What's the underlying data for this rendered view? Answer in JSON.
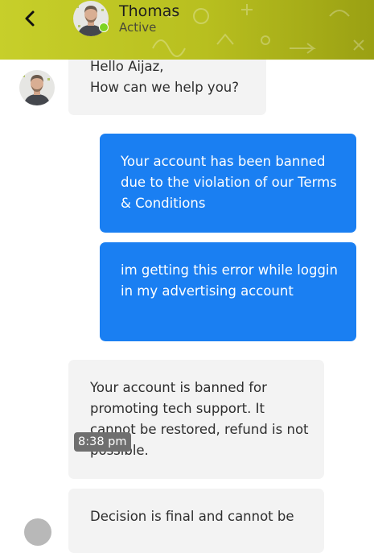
{
  "header": {
    "contact_name": "Thomas",
    "status": "Active",
    "back_icon": "chevron-left-icon",
    "avatar": "avatar",
    "background_color": "#c0c824",
    "online_color": "#7ed321"
  },
  "messages": [
    {
      "direction": "incoming",
      "text": "Hello Aijaz,\nHow can we help you?"
    },
    {
      "direction": "outgoing",
      "text": "Your account has been banned due to the violation of our Terms & Conditions"
    },
    {
      "direction": "outgoing",
      "text": "im getting this error while loggin in my advertising account"
    },
    {
      "direction": "incoming",
      "text": "Your account is banned for promoting tech support. It cannot be restored, refund is not possible."
    },
    {
      "direction": "incoming",
      "text": "Decision is final and cannot be"
    }
  ],
  "timestamp": "8:38 pm",
  "colors": {
    "incoming_bubble": "#f3f3f3",
    "outgoing_bubble": "#1a7ff2",
    "timestamp_badge": "#6f6f6f"
  }
}
